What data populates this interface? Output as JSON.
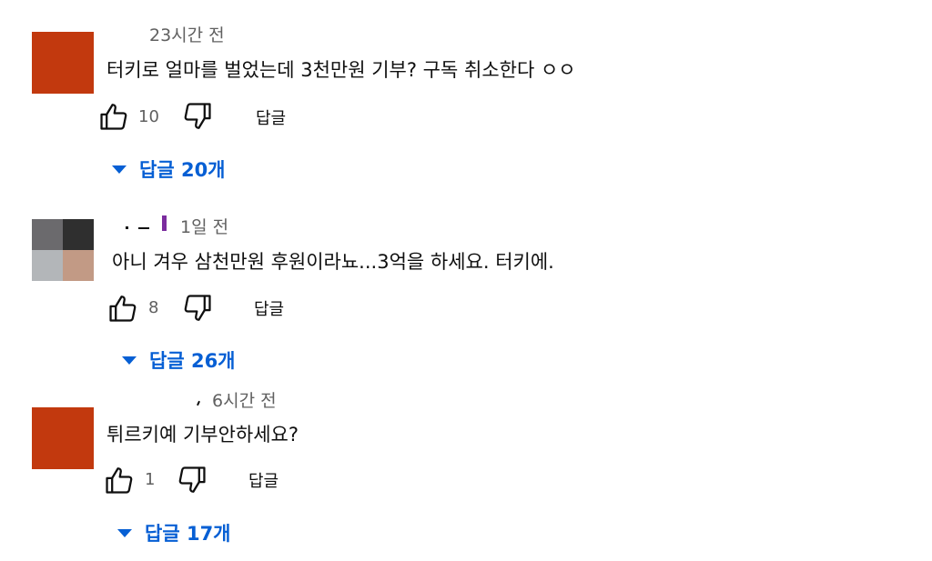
{
  "colors": {
    "link": "#065fd4",
    "avatar_orange": "#c2390e"
  },
  "comments": [
    {
      "timestamp": "23시간 전",
      "text": "터키로 얼마를 벌었는데 3천만원 기부? 구독 취소한다 ㅇㅇ",
      "likes": "10",
      "reply_label": "답글",
      "replies_label": "답글 20개",
      "avatar": "orange-square"
    },
    {
      "timestamp": "1일 전",
      "text": "아니 겨우 삼천만원 후원이라뇨...3억을 하세요. 터키에.",
      "likes": "8",
      "reply_label": "답글",
      "replies_label": "답글 26개",
      "avatar": "pixelated-photo"
    },
    {
      "timestamp": "6시간 전",
      "text": "튀르키예 기부안하세요?",
      "likes": "1",
      "reply_label": "답글",
      "replies_label": "답글 17개",
      "avatar": "orange-square"
    }
  ]
}
